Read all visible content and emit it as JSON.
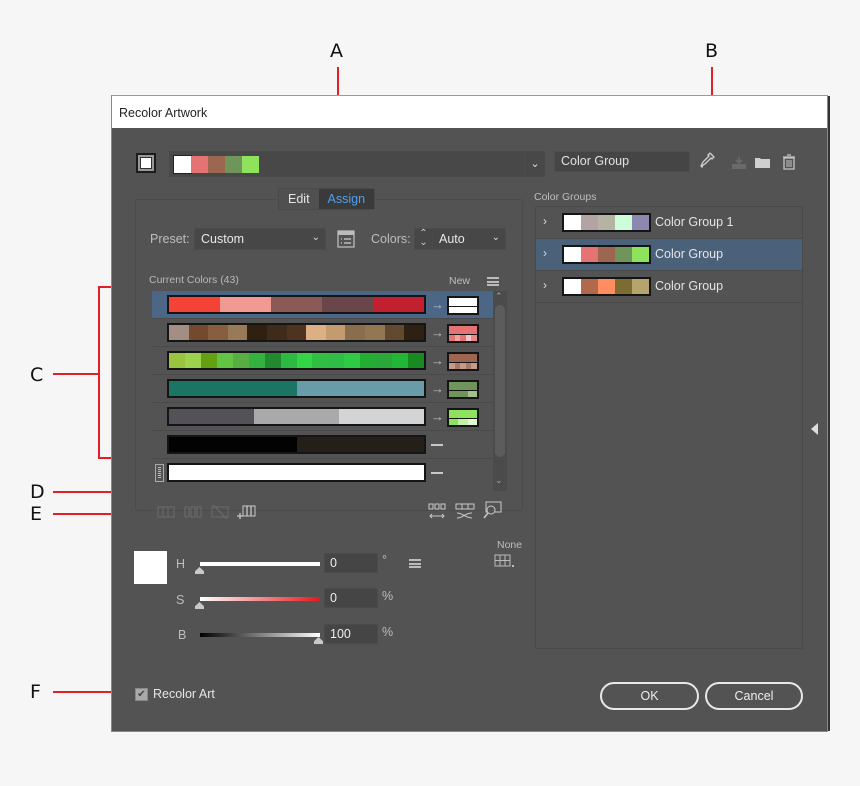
{
  "callouts": [
    "A",
    "B",
    "C",
    "D",
    "E",
    "F"
  ],
  "dialog": {
    "title": "Recolor Artwork",
    "harmony_colors": [
      "#ffffff",
      "#e57373",
      "#9c6650",
      "#6f955a",
      "#8fe25c"
    ],
    "color_group_name": "Color Group",
    "tools": {
      "eyedropper": "eyedropper-icon",
      "save": "save-changes-icon",
      "new_group": "new-folder-icon",
      "delete": "trash-icon"
    },
    "tabs": [
      {
        "label": "Edit",
        "active": false
      },
      {
        "label": "Assign",
        "active": true
      }
    ],
    "preset_label": "Preset:",
    "preset_value": "Custom",
    "colors_label": "Colors:",
    "colors_value": "Auto",
    "current_colors_label": "Current Colors (43)",
    "new_label": "New",
    "color_rows": [
      {
        "selected": true,
        "current": [
          "#f44336",
          "#f19a94",
          "#8c5a56",
          "#6a464a",
          "#c21f30"
        ],
        "mapping": "arrow",
        "new_top": "#ffffff",
        "new_bottom": [
          "#ffffff"
        ]
      },
      {
        "selected": false,
        "current": [
          "#a28e83",
          "#744a2e",
          "#875f40",
          "#987958",
          "#2f2012",
          "#3f2b1a",
          "#4d3320",
          "#dcb084",
          "#c49b71",
          "#8a6d4d",
          "#927852",
          "#624a30",
          "#2e2012"
        ],
        "mapping": "arrow",
        "new_top": "#e57373",
        "new_bottom": [
          "#e57373",
          "#f2a1a1",
          "#e57373",
          "#f7c4c4",
          "#e98a8a"
        ]
      },
      {
        "selected": false,
        "current": [
          "#9ac440",
          "#9dd24e",
          "#63a012",
          "#62c442",
          "#58ae43",
          "#35b140",
          "#228a2e",
          "#2eb944",
          "#34d447",
          "#30bf43",
          "#30bd45",
          "#2fca45",
          "#24ad35",
          "#2ba63a",
          "#22b636",
          "#178b22"
        ],
        "mapping": "arrow",
        "new_top": "#9c6650",
        "new_bottom": [
          "#c49a88",
          "#a87a66",
          "#c49a88",
          "#a87a66",
          "#c49a88"
        ]
      },
      {
        "selected": false,
        "current": [
          "#1a7565",
          "#679ca8"
        ],
        "mapping": "arrow",
        "new_top": "#6f955a",
        "new_bottom": [
          "#6f955a",
          "#6f955a",
          "#a1c08d"
        ]
      },
      {
        "selected": false,
        "current": [
          "#545158",
          "#a9a9ab",
          "#d3d4d5"
        ],
        "mapping": "arrow",
        "new_top": "#8fe25c",
        "new_bottom": [
          "#8fe25c",
          "#c3f1a7",
          "#e1f8d3"
        ]
      },
      {
        "selected": false,
        "current": [
          "#020202",
          "#241f19"
        ],
        "mapping": "none"
      },
      {
        "selected": false,
        "current": [
          "#ffffff"
        ],
        "mapping": "none",
        "locked": true
      }
    ],
    "bottom_tools_left": [
      "merge-colors-icon",
      "separate-colors-icon",
      "exclude-colors-icon",
      "new-row-icon"
    ],
    "bottom_tools_right": [
      "randomize-order-icon",
      "randomize-saturation-brightness-icon",
      "find-color-icon"
    ],
    "selected_color": "#ffffff",
    "hsb": [
      {
        "label": "H",
        "value": "0",
        "unit": "°"
      },
      {
        "label": "S",
        "value": "0",
        "unit": "%"
      },
      {
        "label": "B",
        "value": "100",
        "unit": "%"
      }
    ],
    "colorize_method_label": "None",
    "color_groups_label": "Color Groups",
    "color_groups": [
      {
        "name": "Color Group 1",
        "selected": false,
        "colors": [
          "#ffffff",
          "#b3a3a2",
          "#b5b4a4",
          "#cdfdd9",
          "#8d89ae"
        ]
      },
      {
        "name": "Color Group",
        "selected": true,
        "colors": [
          "#ffffff",
          "#e57373",
          "#9c6650",
          "#6f955a",
          "#8fe25c"
        ]
      },
      {
        "name": "Color Group",
        "selected": false,
        "colors": [
          "#ffffff",
          "#b06a4b",
          "#ff8d5f",
          "#7b6d31",
          "#b5a46d"
        ]
      }
    ],
    "recolor_art_label": "Recolor Art",
    "recolor_art_checked": true,
    "ok_label": "OK",
    "cancel_label": "Cancel"
  }
}
